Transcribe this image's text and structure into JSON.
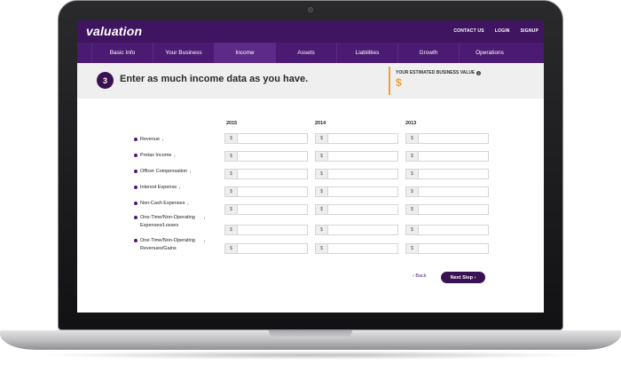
{
  "header": {
    "logo": "valuation",
    "links": [
      "CONTACT US",
      "LOGIN",
      "SIGNUP"
    ]
  },
  "nav": {
    "tabs": [
      "Basic Info",
      "Your Business",
      "Income",
      "Assets",
      "Liabilities",
      "Growth",
      "Operations"
    ],
    "active": "Income"
  },
  "step": {
    "number": "3",
    "title": "Enter as much income data as you have."
  },
  "estimate": {
    "label": "YOUR ESTIMATED BUSINESS VALUE",
    "value": "$"
  },
  "table": {
    "years": [
      "2015",
      "2014",
      "2013"
    ],
    "currency_symbol": "$",
    "rows": [
      {
        "label": "Revenue"
      },
      {
        "label": "Pretax Income"
      },
      {
        "label": "Officer Compensation"
      },
      {
        "label": "Interest Expense"
      },
      {
        "label": "Non-Cash Expenses"
      },
      {
        "label": "One-Time/Non-Operating Expenses/Losses"
      },
      {
        "label": "One-Time/Non-Operating Revenues/Gains"
      }
    ]
  },
  "actions": {
    "back": "‹ Back",
    "next": "Next Step ›"
  },
  "colors": {
    "brand_dark": "#3f1561",
    "brand_nav": "#4b1a72",
    "accent": "#f0a030"
  }
}
